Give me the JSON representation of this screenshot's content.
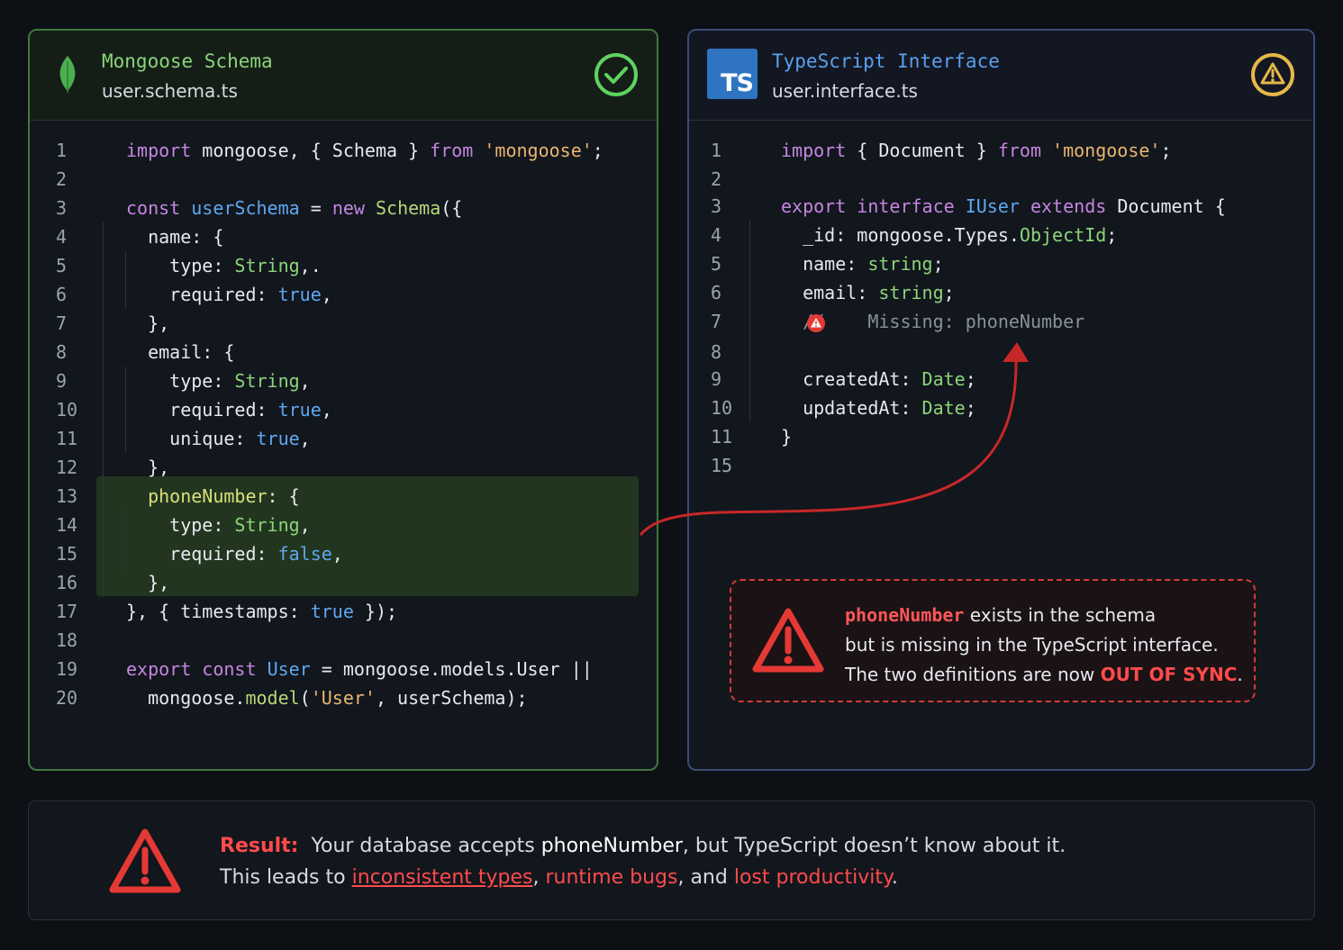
{
  "left_panel": {
    "title": "Mongoose Schema",
    "file": "user.schema.ts",
    "lines": [
      {
        "n": "1",
        "html": "<span class='kw'>import</span> mongoose, { Schema } <span class='kw'>from</span> <span class='str'>'mongoose'</span>;"
      },
      {
        "n": "2",
        "html": ""
      },
      {
        "n": "3",
        "html": "<span class='kw'>const</span> <span class='kb'>userSchema</span> = <span class='kw'>new</span> <span class='fn'>Schema</span>({"
      },
      {
        "n": "4",
        "html": "  name: {"
      },
      {
        "n": "5",
        "html": "    type: <span class='ty'>String</span>,."
      },
      {
        "n": "6",
        "html": "    required: <span class='bool'>true</span>,"
      },
      {
        "n": "7",
        "html": "  },"
      },
      {
        "n": "8",
        "html": "  email: {"
      },
      {
        "n": "9",
        "html": "    type: <span class='ty'>String</span>,"
      },
      {
        "n": "10",
        "html": "    required: <span class='bool'>true</span>,"
      },
      {
        "n": "11",
        "html": "    unique: <span class='bool'>true</span>,"
      },
      {
        "n": "12",
        "html": "  },"
      },
      {
        "n": "13",
        "html": "  <span class='ph'>phoneNumber</span>: {"
      },
      {
        "n": "14",
        "html": "    type: <span class='ty'>String</span>,"
      },
      {
        "n": "15",
        "html": "    required: <span class='bool'>false</span>,"
      },
      {
        "n": "16",
        "html": "  },"
      },
      {
        "n": "17",
        "html": "}, { timestamps: <span class='bool'>true</span> });"
      },
      {
        "n": "18",
        "html": ""
      },
      {
        "n": "19",
        "html": "<span class='kw'>export</span> <span class='kw'>const</span> <span class='kb'>User</span> = mongoose.models.User ||"
      },
      {
        "n": "20",
        "html": "  mongoose.<span class='fn'>model</span>(<span class='str'>'User'</span>, userSchema);"
      }
    ]
  },
  "right_panel": {
    "title": "TypeScript Interface",
    "file": "user.interface.ts",
    "logo_text": "TS",
    "lines": [
      {
        "n": "1",
        "html": "<span class='kw'>import</span> { Document } <span class='kw'>from</span> <span class='str'>'mongoose'</span>;"
      },
      {
        "n": "2",
        "html": ""
      },
      {
        "n": "3",
        "html": "<span class='kw'>export</span> <span class='kw'>interface</span> <span class='kb'>IUser</span> <span class='kw'>extends</span> Document {"
      },
      {
        "n": "4",
        "html": "  _id: mongoose.Types.<span class='ty'>ObjectId</span>;"
      },
      {
        "n": "5",
        "html": "  name: <span class='ty'>string</span>;"
      },
      {
        "n": "6",
        "html": "  email: <span class='ty'>string</span>;"
      },
      {
        "n": "7",
        "html": "  <span class='cmt'>//    Missing: phoneNumber</span>"
      },
      {
        "n": "8",
        "html": ""
      },
      {
        "n": "9",
        "html": "  createdAt: <span class='ty'>Date</span>;"
      },
      {
        "n": "10",
        "html": "  updatedAt: <span class='ty'>Date</span>;"
      },
      {
        "n": "11",
        "html": "}"
      },
      {
        "n": "15",
        "html": ""
      }
    ]
  },
  "callout": {
    "keyword": "phoneNumber",
    "line1_rest": " exists in the schema",
    "line2": "but is missing in the TypeScript interface.",
    "line3_pre": "The two definitions are now ",
    "line3_strong": "OUT OF SYNC",
    "line3_post": "."
  },
  "result": {
    "label": "Result:",
    "line1_a": "  Your database accepts ",
    "line1_b": "phoneNumber",
    "line1_c": ", but TypeScript doesn’t know about it.",
    "line2_a": "This leads to ",
    "link1": "inconsistent types",
    "sep1": ", ",
    "link2": "runtime bugs",
    "sep2": ", and ",
    "link3": "lost productivity",
    "end": "."
  },
  "colors": {
    "left_accent": "#3e7a3e",
    "right_accent": "#3b4c7a",
    "error_red": "#d13b3b",
    "check_green": "#5fd35f",
    "warn_yellow": "#e6b84a"
  },
  "icons": [
    "leaf-icon",
    "check-circle-icon",
    "ts-logo",
    "warning-circle-icon",
    "warning-triangle-icon",
    "arrow-connector"
  ]
}
